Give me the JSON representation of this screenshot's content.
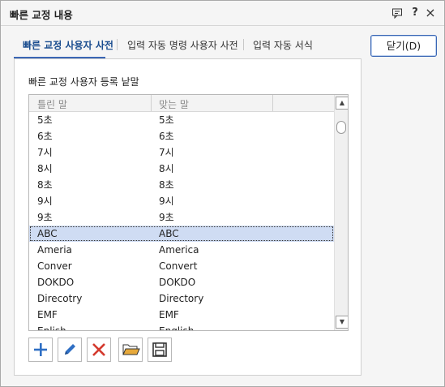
{
  "window": {
    "title": "빠른 교정 내용"
  },
  "title_buttons": {
    "help": "?",
    "close": "×"
  },
  "tabs": [
    {
      "label": "빠른 교정 사용자 사전"
    },
    {
      "label": "입력 자동 명령 사용자 사전"
    },
    {
      "label": "입력 자동 서식"
    }
  ],
  "panel": {
    "label": "빠른 교정 사용자 등록 낱말"
  },
  "list": {
    "columns": [
      "틀린 말",
      "맞는 말"
    ],
    "rows": [
      [
        "5초",
        "5초"
      ],
      [
        "6초",
        "6초"
      ],
      [
        "7시",
        "7시"
      ],
      [
        "8시",
        "8시"
      ],
      [
        "8초",
        "8초"
      ],
      [
        "9시",
        "9시"
      ],
      [
        "9초",
        "9초"
      ],
      [
        "ABC",
        "ABC"
      ],
      [
        "Ameria",
        "America"
      ],
      [
        "Conver",
        "Convert"
      ],
      [
        "DOKDO",
        "DOKDO"
      ],
      [
        "Direcotry",
        "Directory"
      ],
      [
        "EMF",
        "EMF"
      ],
      [
        "Enlish",
        "English"
      ]
    ],
    "selected_row": "ABC"
  },
  "toolbar": {
    "icons": [
      "add-icon",
      "edit-pencil-icon",
      "delete-x-icon",
      "open-folder-icon",
      "save-disk-icon"
    ]
  },
  "close_button": {
    "label": "닫기(D)"
  },
  "colors": {
    "accent": "#3a66b4",
    "selection": "#cfdcf3",
    "add": "#2f6fc4",
    "delete": "#d43a2e",
    "folder": "#e7a93b"
  }
}
